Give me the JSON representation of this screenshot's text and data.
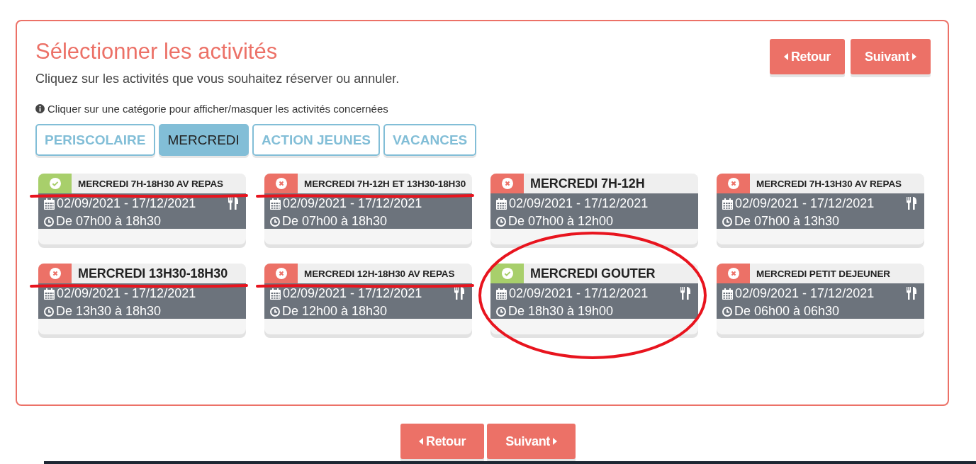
{
  "title": "Sélectionner les activités",
  "subtitle": "Cliquez sur les activités que vous souhaitez réserver ou annuler.",
  "top_buttons": [
    {
      "label": "Retour",
      "kind": "back"
    },
    {
      "label": "Suivant",
      "kind": "next"
    }
  ],
  "hint": "Cliquer sur une catégorie pour afficher/masquer les activités concernées",
  "tabs": [
    {
      "label": "PERISCOLAIRE",
      "selected": false
    },
    {
      "label": "MERCREDI",
      "selected": true
    },
    {
      "label": "ACTION JEUNES",
      "selected": false
    },
    {
      "label": "VACANCES",
      "selected": false
    }
  ],
  "activities": [
    {
      "title": "MERCREDI 7H-18H30 AV REPAS",
      "reserved": true,
      "dates": "02/09/2021 - 17/12/2021",
      "hours": "De 07h00 à 18h30",
      "meal": true,
      "underlined": true,
      "circled": false
    },
    {
      "title": "MERCREDI 7H-12H ET 13H30-18H30",
      "reserved": false,
      "dates": "02/09/2021 - 17/12/2021",
      "hours": "De 07h00 à 18h30",
      "meal": false,
      "underlined": true,
      "circled": false
    },
    {
      "title": "MERCREDI 7H-12H",
      "reserved": false,
      "dates": "02/09/2021 - 17/12/2021",
      "hours": "De 07h00 à 12h00",
      "meal": false,
      "underlined": false,
      "circled": false
    },
    {
      "title": "MERCREDI 7H-13H30 AV REPAS",
      "reserved": false,
      "dates": "02/09/2021 - 17/12/2021",
      "hours": "De 07h00 à 13h30",
      "meal": true,
      "underlined": false,
      "circled": false
    },
    {
      "title": "MERCREDI 13H30-18H30",
      "reserved": false,
      "dates": "02/09/2021 - 17/12/2021",
      "hours": "De 13h30 à 18h30",
      "meal": false,
      "underlined": true,
      "circled": false
    },
    {
      "title": "MERCREDI 12H-18H30 AV REPAS",
      "reserved": false,
      "dates": "02/09/2021 - 17/12/2021",
      "hours": "De 12h00 à 18h30",
      "meal": true,
      "underlined": true,
      "circled": false
    },
    {
      "title": "MERCREDI GOUTER",
      "reserved": true,
      "dates": "02/09/2021 - 17/12/2021",
      "hours": "De 18h30 à 19h00",
      "meal": true,
      "underlined": false,
      "circled": true
    },
    {
      "title": "MERCREDI PETIT DEJEUNER",
      "reserved": false,
      "dates": "02/09/2021 - 17/12/2021",
      "hours": "De 06h00 à 06h30",
      "meal": true,
      "underlined": false,
      "circled": false
    }
  ],
  "bottom_buttons": [
    {
      "label": "Retour",
      "kind": "back"
    },
    {
      "label": "Suivant",
      "kind": "next"
    }
  ]
}
